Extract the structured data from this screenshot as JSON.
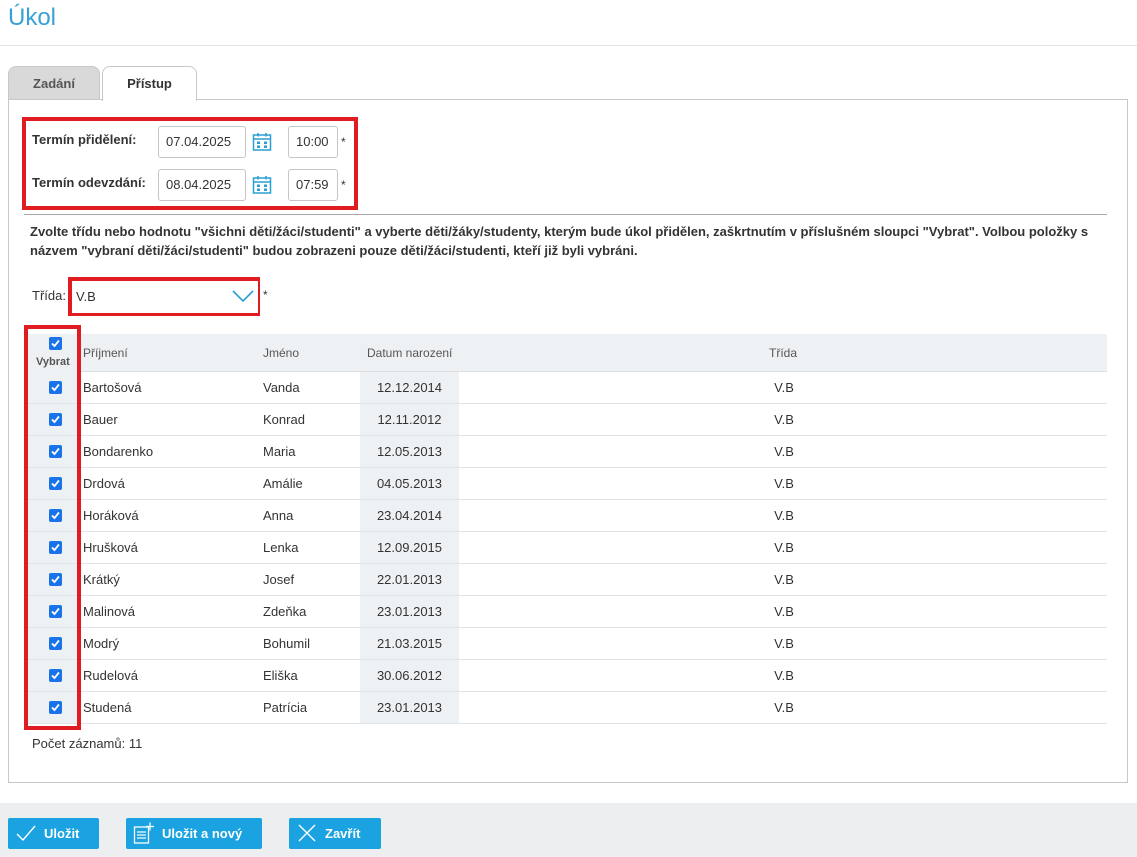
{
  "page": {
    "title": "Úkol"
  },
  "tabs": [
    {
      "label": "Zadání",
      "active": false
    },
    {
      "label": "Přístup",
      "active": true
    }
  ],
  "assignment": {
    "assigned_label": "Termín přidělení:",
    "assigned_date": "07.04.2025",
    "assigned_time": "10:00",
    "due_label": "Termín odevzdání:",
    "due_date": "08.04.2025",
    "due_time": "07:59",
    "required_mark": "*"
  },
  "instructions": "Zvolte třídu nebo hodnotu \"všichni děti/žáci/studenti\" a vyberte děti/žáky/studenty, kterým bude úkol přidělen, zaškrtnutím v příslušném sloupci \"Vybrat\". Volbou položky s názvem \"vybraní děti/žáci/studenti\" budou zobrazeni pouze děti/žáci/studenti, kteří již byli vybráni.",
  "class_filter": {
    "label": "Třída:",
    "value": "V.B",
    "required_mark": "*"
  },
  "table": {
    "headers": {
      "select": "Vybrat",
      "surname": "Příjmení",
      "name": "Jméno",
      "birth": "Datum narození",
      "class": "Třída"
    },
    "rows": [
      {
        "selected": true,
        "surname": "Bartošová",
        "name": "Vanda",
        "birth": "12.12.2014",
        "class": "V.B"
      },
      {
        "selected": true,
        "surname": "Bauer",
        "name": "Konrad",
        "birth": "12.11.2012",
        "class": "V.B"
      },
      {
        "selected": true,
        "surname": "Bondarenko",
        "name": "Maria",
        "birth": "12.05.2013",
        "class": "V.B"
      },
      {
        "selected": true,
        "surname": "Drdová",
        "name": "Amálie",
        "birth": "04.05.2013",
        "class": "V.B"
      },
      {
        "selected": true,
        "surname": "Horáková",
        "name": "Anna",
        "birth": "23.04.2014",
        "class": "V.B"
      },
      {
        "selected": true,
        "surname": "Hrušková",
        "name": "Lenka",
        "birth": "12.09.2015",
        "class": "V.B"
      },
      {
        "selected": true,
        "surname": "Krátký",
        "name": "Josef",
        "birth": "22.01.2013",
        "class": "V.B"
      },
      {
        "selected": true,
        "surname": "Malinová",
        "name": "Zdeňka",
        "birth": "23.01.2013",
        "class": "V.B"
      },
      {
        "selected": true,
        "surname": "Modrý",
        "name": "Bohumil",
        "birth": "21.03.2015",
        "class": "V.B"
      },
      {
        "selected": true,
        "surname": "Rudelová",
        "name": "Eliška",
        "birth": "30.06.2012",
        "class": "V.B"
      },
      {
        "selected": true,
        "surname": "Studená",
        "name": "Patrícia",
        "birth": "23.01.2013",
        "class": "V.B"
      }
    ],
    "record_count": "Počet záznamů: 11"
  },
  "footer": {
    "save_label": "Uložit",
    "save_new_label": "Uložit a nový",
    "close_label": "Zavřít"
  },
  "colors": {
    "accent": "#1aa3e0",
    "title": "#3aa0d5",
    "highlight": "#e11b22",
    "checkbox": "#1a73e8"
  }
}
